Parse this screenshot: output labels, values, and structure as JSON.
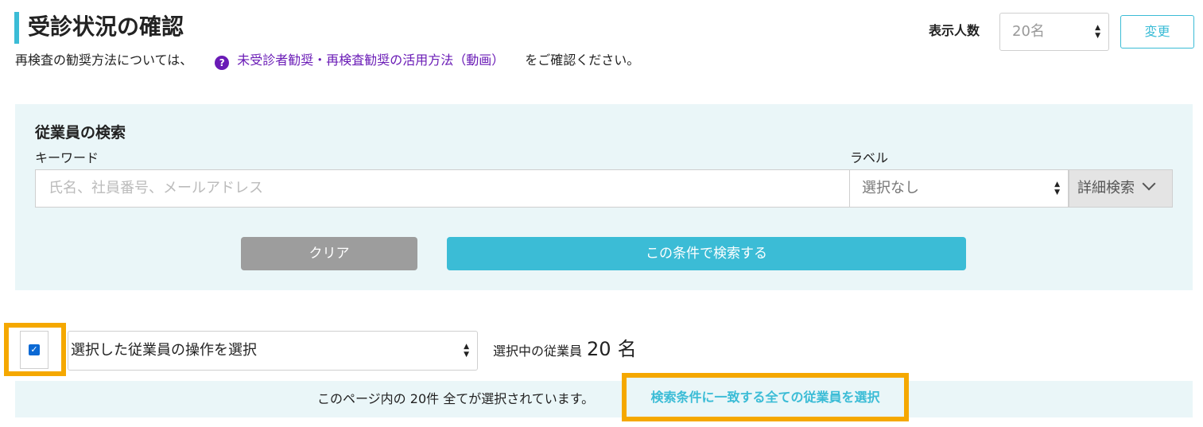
{
  "header": {
    "title": "受診状況の確認",
    "help_prefix": "再検査の勧奨方法については、",
    "help_icon": "?",
    "help_link": "未受診者勧奨・再検査勧奨の活用方法（動画）",
    "help_suffix": "をご確認ください。",
    "per_page_label": "表示人数",
    "per_page_value": "20名",
    "change_button": "変更"
  },
  "search": {
    "heading": "従業員の検索",
    "keyword_label": "キーワード",
    "keyword_placeholder": "氏名、社員番号、メールアドレス",
    "label_label": "ラベル",
    "label_value": "選択なし",
    "advanced_button": "詳細検索",
    "clear_button": "クリア",
    "search_button": "この条件で検索する"
  },
  "selection": {
    "checkbox_checked": true,
    "operation_placeholder": "選択した従業員の操作を選択",
    "count_label": "選択中の従業員",
    "count_value": "20",
    "count_unit": "名"
  },
  "notice": {
    "text": "このページ内の 20件 全てが選択されています。",
    "select_all_link": "検索条件に一致する全ての従業員を選択"
  },
  "colors": {
    "accent": "#3bbcd6",
    "link_purple": "#6a1bb6",
    "highlight": "#f5a800",
    "panel_bg": "#eaf6f8"
  }
}
